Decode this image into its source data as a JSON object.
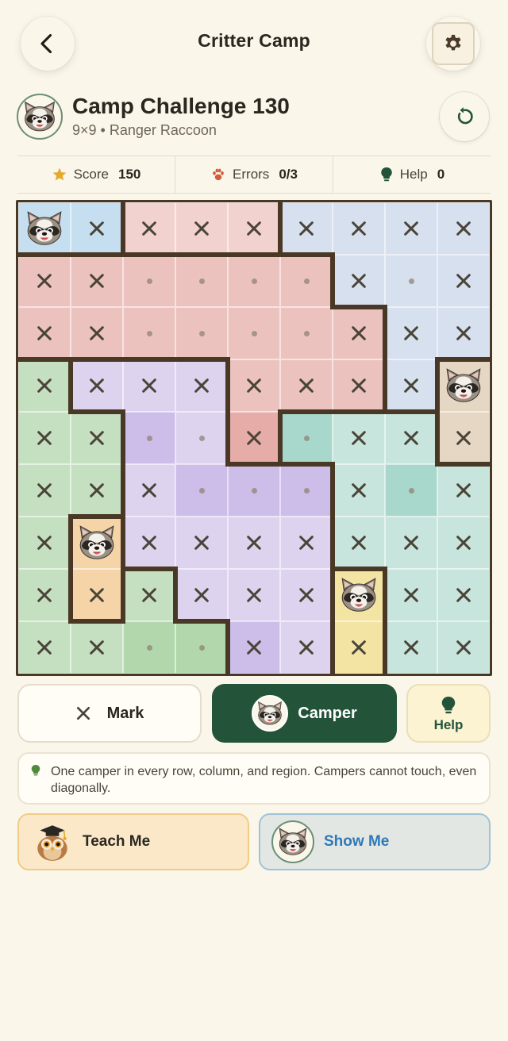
{
  "app": {
    "title": "Critter Camp"
  },
  "puzzle": {
    "title": "Camp Challenge 130",
    "subtitle": "9×9 • Ranger Raccoon"
  },
  "stats": {
    "score_label": "Score",
    "score_value": "150",
    "errors_label": "Errors",
    "errors_value": "0/3",
    "help_label": "Help",
    "help_value": "0"
  },
  "colors": {
    "accent_green": "#23543a",
    "board_border": "#4a3826",
    "regions": {
      "A": "#c5dff0",
      "B": "#ecc2bf",
      "C": "#f2d2cf",
      "D": "#d7e0ee",
      "E": "#c5e0c1",
      "F": "#ded3ef",
      "G": "#c7e5dc",
      "H": "#e6d6c4",
      "I": "#f5d5a8",
      "J": "#f4e4a4"
    }
  },
  "board": {
    "size": 9,
    "regions": [
      "AACCCDDDD",
      "BBBBBBDDD",
      "BBBBBBBDD",
      "EFFFBBBDH",
      "EEFFBGGGH",
      "EEFFFFGGG",
      "EIFFFFGGG",
      "EIEFFFJGG",
      "EEEEFFJGG"
    ],
    "cells": [
      "RXXXXXXXX",
      "XX....X.X",
      "XX....XXX",
      "XXXXXXXXR",
      "XX..X.XXX",
      "XXX...X.X",
      "XRXXXXXXX",
      "XXXXXXRXX",
      "XX..XXXXX"
    ],
    "cell_strong": [
      "BBBBBBBBB",
      "BBBBBBBBB",
      "BBBBBBBBB",
      "BBBBBBBBB",
      "BBSBSSBBB",
      "BBBSSSBSB",
      "BBBBBBBBB",
      "BBBBBBBBB",
      "BBSSSBBBB"
    ]
  },
  "actions": {
    "mark_label": "Mark",
    "camper_label": "Camper",
    "help_label": "Help"
  },
  "hint": {
    "text": "One camper in every row, column, and region. Campers cannot touch, even diagonally."
  },
  "buttons": {
    "teach_label": "Teach Me",
    "show_label": "Show Me"
  },
  "icons": {
    "back": "chevron-left-icon",
    "settings": "gear-icon",
    "reset": "reset-icon",
    "score": "star-icon",
    "errors": "paw-icon",
    "help": "bulb-icon",
    "camper": "raccoon-icon",
    "teach": "owl-icon"
  }
}
